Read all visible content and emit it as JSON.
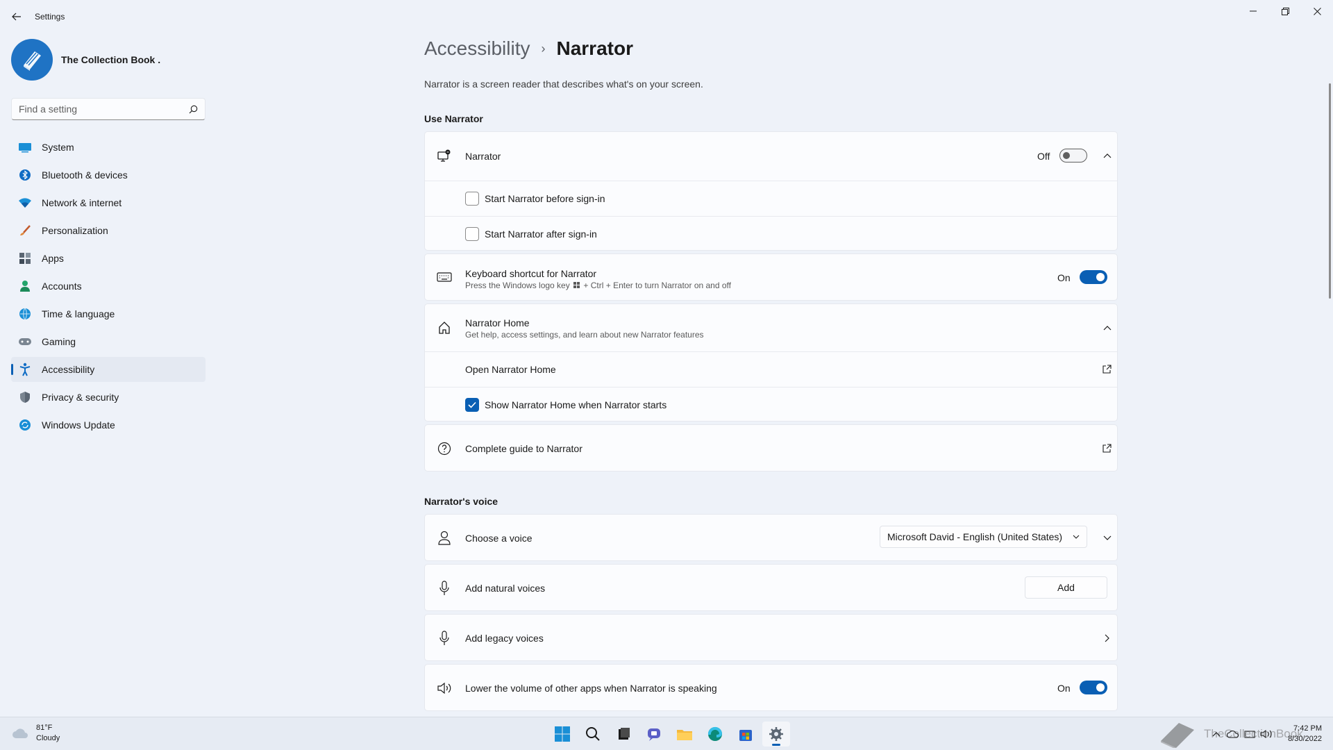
{
  "window": {
    "title": "Settings"
  },
  "profile": {
    "name": "The Collection Book ."
  },
  "search": {
    "placeholder": "Find a setting"
  },
  "sidebar": {
    "items": [
      {
        "label": "System",
        "icon": "system-icon"
      },
      {
        "label": "Bluetooth & devices",
        "icon": "bluetooth-icon"
      },
      {
        "label": "Network & internet",
        "icon": "wifi-icon"
      },
      {
        "label": "Personalization",
        "icon": "brush-icon"
      },
      {
        "label": "Apps",
        "icon": "apps-icon"
      },
      {
        "label": "Accounts",
        "icon": "accounts-icon"
      },
      {
        "label": "Time & language",
        "icon": "globe-icon"
      },
      {
        "label": "Gaming",
        "icon": "gamepad-icon"
      },
      {
        "label": "Accessibility",
        "icon": "accessibility-icon",
        "active": true
      },
      {
        "label": "Privacy & security",
        "icon": "shield-icon"
      },
      {
        "label": "Windows Update",
        "icon": "update-icon"
      }
    ]
  },
  "header": {
    "parent": "Accessibility",
    "separator": "›",
    "current": "Narrator",
    "description": "Narrator is a screen reader that describes what's on your screen."
  },
  "use_narrator": {
    "section_title": "Use Narrator",
    "narrator": {
      "label": "Narrator",
      "state_label": "Off",
      "on": false,
      "expanded": true
    },
    "before_signin": {
      "label": "Start Narrator before sign-in",
      "checked": false
    },
    "after_signin": {
      "label": "Start Narrator after sign-in",
      "checked": false
    },
    "shortcut": {
      "title": "Keyboard shortcut for Narrator",
      "subtitle_pre": "Press the Windows logo key",
      "subtitle_post": "+ Ctrl + Enter to turn Narrator on and off",
      "state_label": "On",
      "on": true
    },
    "home": {
      "title": "Narrator Home",
      "subtitle": "Get help, access settings, and learn about new Narrator features",
      "open_label": "Open Narrator Home",
      "show_label": "Show Narrator Home when Narrator starts",
      "show_checked": true
    },
    "guide": {
      "label": "Complete guide to Narrator"
    }
  },
  "voice": {
    "section_title": "Narrator's voice",
    "choose": {
      "label": "Choose a voice",
      "selected": "Microsoft David - English (United States)"
    },
    "natural": {
      "label": "Add natural voices",
      "button": "Add"
    },
    "legacy": {
      "label": "Add legacy voices"
    },
    "lower_volume": {
      "label": "Lower the volume of other apps when Narrator is speaking",
      "state_label": "On",
      "on": true
    }
  },
  "taskbar": {
    "weather_temp": "81°F",
    "weather_desc": "Cloudy",
    "time": "7:42 PM",
    "date": "8/30/2022",
    "watermark": "TheCollectionBook"
  },
  "colors": {
    "accent": "#0a5fb4",
    "background": "#eef2f9",
    "card": "#fbfcfe"
  }
}
